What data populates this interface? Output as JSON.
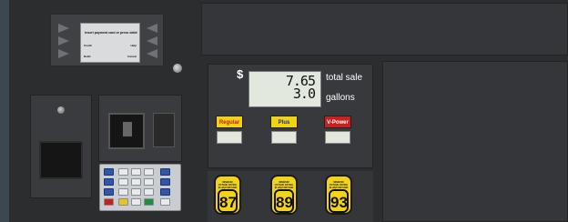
{
  "screen": {
    "message": "Insert payment card or press debit",
    "left_top": "Credit",
    "left_bottom": "Debit",
    "right_top": "Help",
    "right_bottom": "Cancel"
  },
  "display": {
    "currency": "$",
    "sale_value": "7.65",
    "sale_label": "total sale",
    "gallons_value": "3.0",
    "gallons_label": "gallons"
  },
  "grades": [
    {
      "label": "Regular",
      "color": "#c6201f",
      "bg": "#f1d316"
    },
    {
      "label": "Plus",
      "color": "#1a2b8a",
      "bg": "#f1d316"
    },
    {
      "label": "V-Power",
      "color": "#ffffff",
      "bg": "#c6201f"
    }
  ],
  "octanes": [
    {
      "value": "87",
      "note": "MINIMUM OCTANE RATING (R+M)/2 METHOD"
    },
    {
      "value": "89",
      "note": "MINIMUM OCTANE RATING (R+M)/2 METHOD"
    },
    {
      "value": "93",
      "note": "MINIMUM OCTANE RATING (R+M)/2 METHOD"
    }
  ],
  "colors": {
    "body": "#2c2d2f",
    "octane_yellow": "#f2d31b",
    "lcd": "#e3e8df"
  }
}
